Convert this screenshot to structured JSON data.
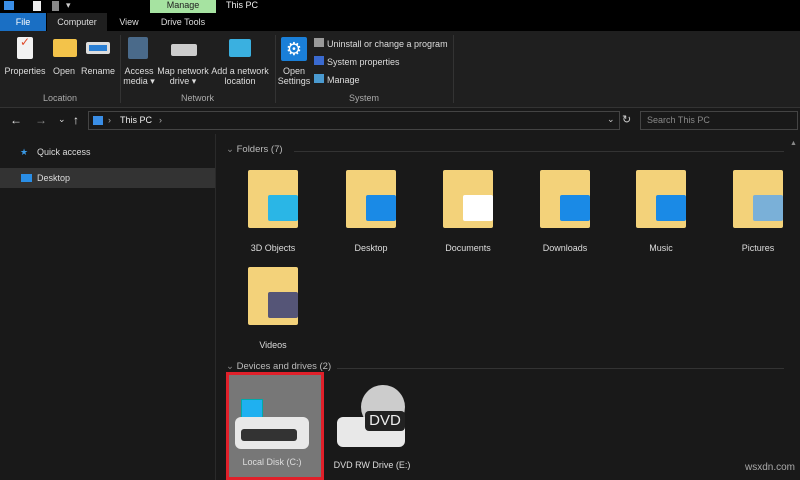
{
  "titlebar": {
    "manage_tab": "Manage",
    "title": "This PC"
  },
  "tabs": [
    "File",
    "Computer",
    "View",
    "Drive Tools"
  ],
  "ribbon": {
    "location": {
      "label": "Location",
      "buttons": [
        "Properties",
        "Open",
        "Rename"
      ]
    },
    "network": {
      "label": "Network",
      "buttons": [
        "Access media ▾",
        "Map network drive ▾",
        "Add a network location"
      ]
    },
    "system": {
      "label": "System",
      "open_settings": "Open Settings",
      "items": [
        "Uninstall or change a program",
        "System properties",
        "Manage"
      ]
    }
  },
  "nav": {
    "path": "This PC",
    "search_placeholder": "Search This PC"
  },
  "sidebar": {
    "items": [
      "Quick access",
      "Desktop"
    ]
  },
  "folders": {
    "header": "Folders (7)",
    "items": [
      "3D Objects",
      "Desktop",
      "Documents",
      "Downloads",
      "Music",
      "Pictures",
      "Videos"
    ]
  },
  "devices": {
    "header": "Devices and drives (2)",
    "items": [
      "Local Disk (C:)",
      "DVD RW Drive (E:)"
    ]
  },
  "dvd_badge": "DVD",
  "watermark": "wsxdn.com",
  "colors": {
    "file_tab": "#1a6fc4",
    "manage_tab": "#a6e3a1",
    "selection_border": "#e0202a",
    "folder": "#f3d27a"
  }
}
